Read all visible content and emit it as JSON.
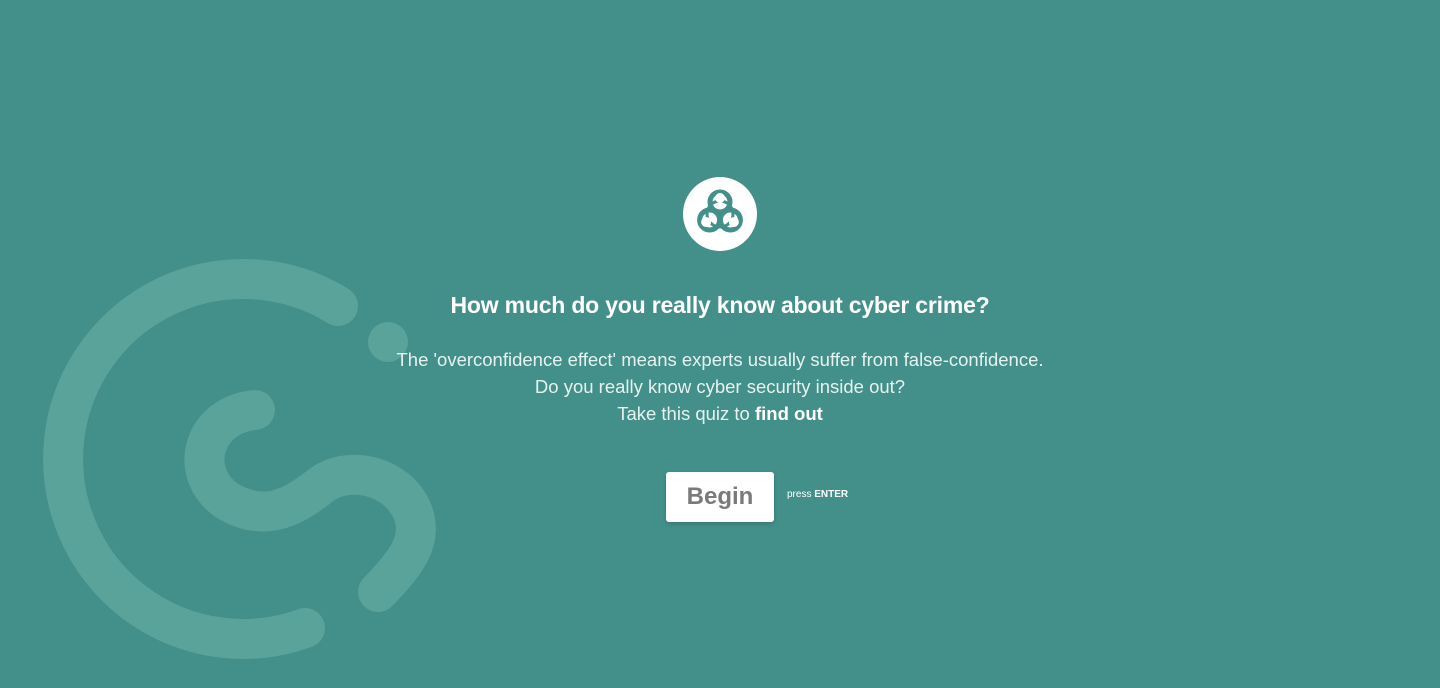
{
  "theme": {
    "background": "#438f89",
    "accent_light": "#5aa39b",
    "button_bg": "#ffffff",
    "button_text": "#7a7a7a"
  },
  "background_logo": {
    "icon": "brand-swirl-logo"
  },
  "emblem": {
    "icon": "biohazard-icon"
  },
  "headline": "How much do you really know about cyber crime?",
  "description": {
    "line1": "The 'overconfidence effect' means experts usually suffer from false-confidence.",
    "line2": "Do you really know cyber security inside out?",
    "line3_prefix": "Take this quiz to ",
    "line3_emphasis": "find out"
  },
  "begin_button": {
    "label": "Begin"
  },
  "enter_hint": {
    "prefix": "press",
    "key": "ENTER"
  }
}
